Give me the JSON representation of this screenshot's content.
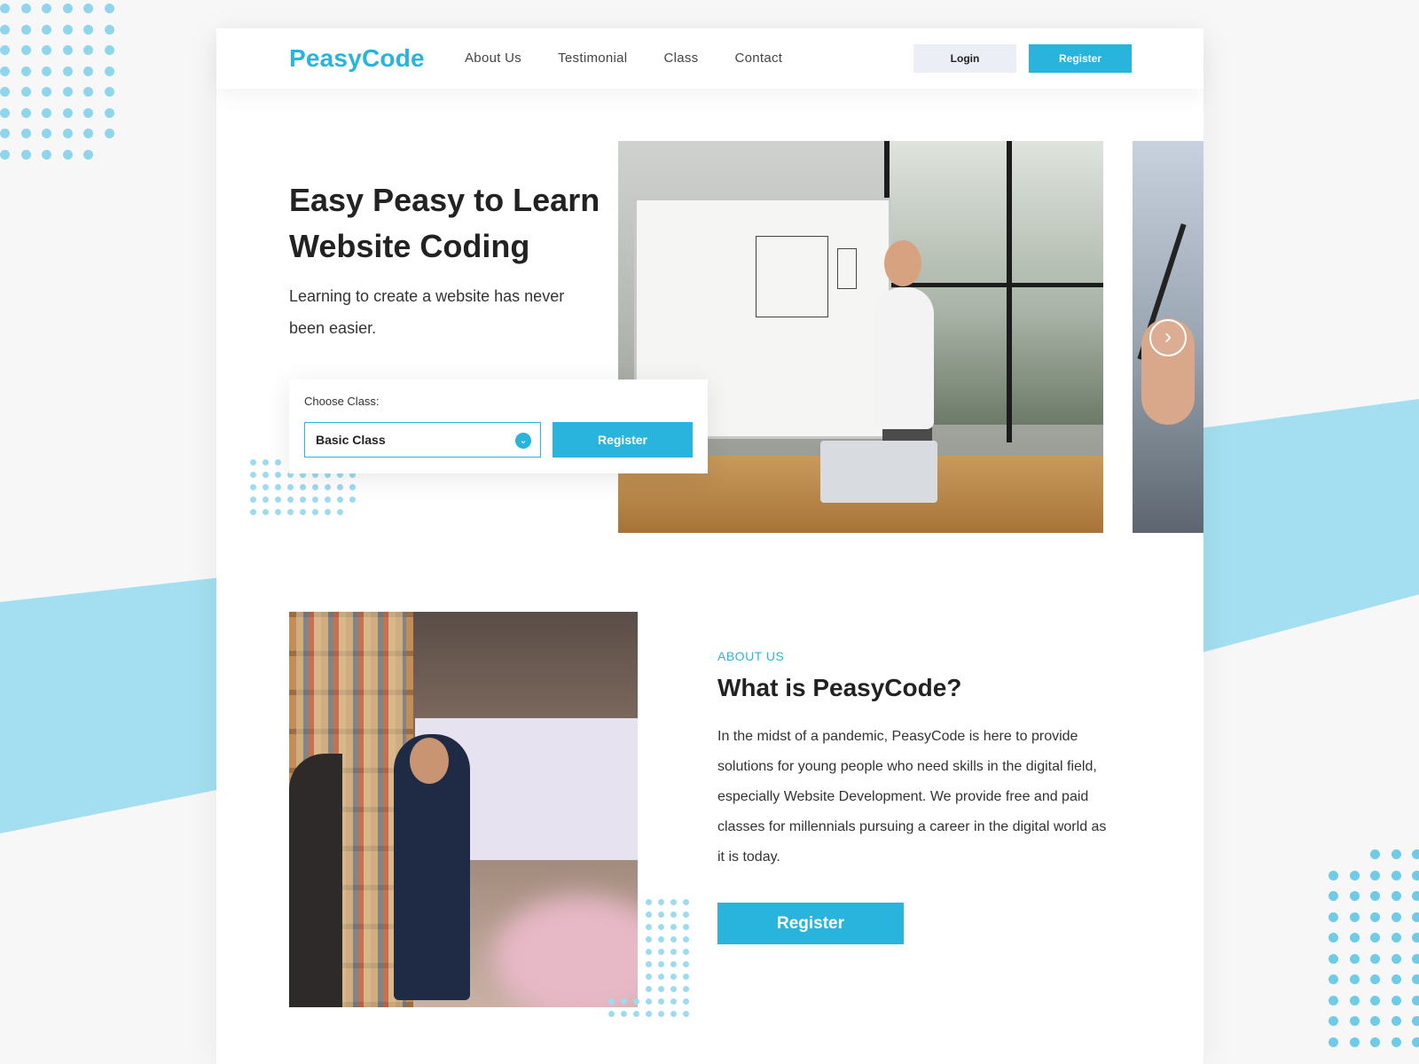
{
  "brand": {
    "logo": "PeasyCode",
    "accent_color": "#28b4dc",
    "stripe_color": "#a3dff0"
  },
  "nav": {
    "links": [
      "About Us",
      "Testimonial",
      "Class",
      "Contact"
    ],
    "login_label": "Login",
    "register_label": "Register"
  },
  "hero": {
    "title": "Easy Peasy to Learn Website Coding",
    "subtitle": "Learning to create a website has never been easier.",
    "class_label": "Choose Class:",
    "class_selected": "Basic Class",
    "register_label": "Register",
    "next_icon": "chevron-right-icon"
  },
  "about": {
    "kicker": "ABOUT US",
    "title": "What is PeasyCode?",
    "text": "In the midst of a pandemic, PeasyCode is here to provide solutions for young people who need skills in the digital field, especially Website Development. We provide free and paid classes for millennials pursuing a career in the digital world as it is today.",
    "register_label": "Register"
  }
}
